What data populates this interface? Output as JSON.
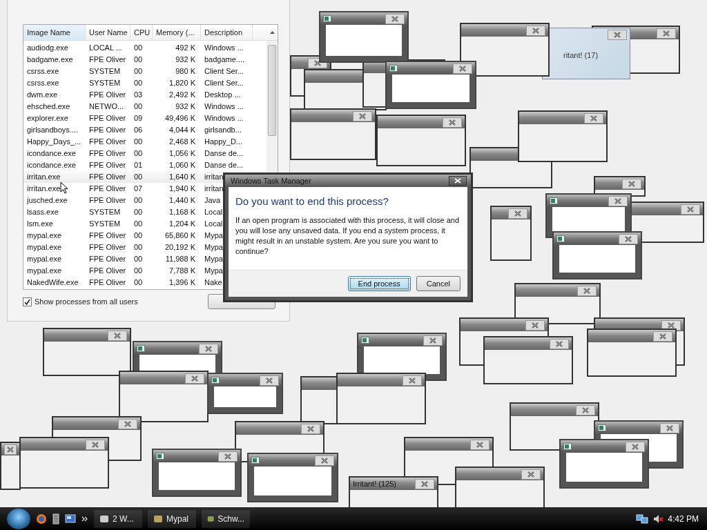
{
  "task_manager": {
    "columns": [
      {
        "label": "Image Name",
        "sorted": true
      },
      {
        "label": "User Name",
        "sorted": false
      },
      {
        "label": "CPU",
        "sorted": false
      },
      {
        "label": "Memory (...",
        "sorted": false
      },
      {
        "label": "Description",
        "sorted": false
      }
    ],
    "rows": [
      {
        "hovered": false,
        "cells": [
          "audiodg.exe",
          "LOCAL ...",
          "00",
          "492 K",
          "Windows ..."
        ]
      },
      {
        "hovered": false,
        "cells": [
          "badgame.exe",
          "FPE Oliver",
          "00",
          "932 K",
          "badgame...."
        ]
      },
      {
        "hovered": false,
        "cells": [
          "csrss.exe",
          "SYSTEM",
          "00",
          "980 K",
          "Client Ser..."
        ]
      },
      {
        "hovered": false,
        "cells": [
          "csrss.exe",
          "SYSTEM",
          "00",
          "1,820 K",
          "Client Ser..."
        ]
      },
      {
        "hovered": false,
        "cells": [
          "dwm.exe",
          "FPE Oliver",
          "03",
          "2,492 K",
          "Desktop ..."
        ]
      },
      {
        "hovered": false,
        "cells": [
          "ehsched.exe",
          "NETWO...",
          "00",
          "932 K",
          "Windows ..."
        ]
      },
      {
        "hovered": false,
        "cells": [
          "explorer.exe",
          "FPE Oliver",
          "09",
          "49,496 K",
          "Windows ..."
        ]
      },
      {
        "hovered": false,
        "cells": [
          "girlsandboys....",
          "FPE Oliver",
          "06",
          "4,044 K",
          "girlsandb..."
        ]
      },
      {
        "hovered": false,
        "cells": [
          "Happy_Days_...",
          "FPE Oliver",
          "00",
          "2,468 K",
          "Happy_D..."
        ]
      },
      {
        "hovered": false,
        "cells": [
          "icondance.exe",
          "FPE Oliver",
          "00",
          "1,056 K",
          "Danse de..."
        ]
      },
      {
        "hovered": false,
        "cells": [
          "icondance.exe",
          "FPE Oliver",
          "01",
          "1,060 K",
          "Danse de..."
        ]
      },
      {
        "hovered": true,
        "cells": [
          "irritan.exe",
          "FPE Oliver",
          "00",
          "1,640 K",
          "irritan"
        ]
      },
      {
        "hovered": false,
        "cells": [
          "irritan.exe",
          "FPE Oliver",
          "07",
          "1,940 K",
          "irritan"
        ]
      },
      {
        "hovered": false,
        "cells": [
          "jusched.exe",
          "FPE Oliver",
          "00",
          "1,440 K",
          "Java"
        ]
      },
      {
        "hovered": false,
        "cells": [
          "lsass.exe",
          "SYSTEM",
          "00",
          "1,168 K",
          "Local"
        ]
      },
      {
        "hovered": false,
        "cells": [
          "lsm.exe",
          "SYSTEM",
          "00",
          "1,204 K",
          "Local"
        ]
      },
      {
        "hovered": false,
        "cells": [
          "mypal.exe",
          "FPE Oliver",
          "00",
          "65,860 K",
          "Mypa"
        ]
      },
      {
        "hovered": false,
        "cells": [
          "mypal.exe",
          "FPE Oliver",
          "00",
          "20,192 K",
          "Mypa"
        ]
      },
      {
        "hovered": false,
        "cells": [
          "mypal.exe",
          "FPE Oliver",
          "00",
          "11,988 K",
          "Mypa"
        ]
      },
      {
        "hovered": false,
        "cells": [
          "mypal.exe",
          "FPE Oliver",
          "00",
          "7,788 K",
          "Mypa"
        ]
      },
      {
        "hovered": false,
        "cells": [
          "NakedWife.exe",
          "FPE Oliver",
          "00",
          "1,396 K",
          "Nake"
        ]
      }
    ],
    "show_all_users": {
      "label": "Show processes from all users",
      "checked": true
    }
  },
  "popups": [
    {
      "kind": "plain"
    },
    {
      "kind": "plain"
    },
    {
      "kind": "plain"
    },
    {
      "kind": "plain"
    },
    {
      "kind": "plain"
    },
    {
      "kind": "framed"
    },
    {
      "kind": "glass",
      "title": "ritant! (17)"
    },
    {
      "kind": "plain"
    },
    {
      "kind": "framed"
    },
    {
      "kind": "plain"
    },
    {
      "kind": "plain"
    },
    {
      "kind": "plain"
    },
    {
      "kind": "plain"
    },
    {
      "kind": "plain"
    },
    {
      "kind": "framed"
    },
    {
      "kind": "framed"
    },
    {
      "kind": "plain"
    },
    {
      "kind": "plain"
    },
    {
      "kind": "plain"
    },
    {
      "kind": "framed"
    },
    {
      "kind": "plain"
    },
    {
      "kind": "framed"
    },
    {
      "kind": "plain"
    },
    {
      "kind": "plain"
    },
    {
      "kind": "plain"
    },
    {
      "kind": "plain"
    },
    {
      "kind": "plain"
    },
    {
      "kind": "plain"
    },
    {
      "kind": "framed"
    },
    {
      "kind": "plain"
    },
    {
      "kind": "plain"
    },
    {
      "kind": "plain"
    },
    {
      "kind": "plain"
    },
    {
      "kind": "plain"
    },
    {
      "kind": "framed"
    },
    {
      "kind": "framed"
    },
    {
      "kind": "plain"
    },
    {
      "kind": "plain"
    },
    {
      "kind": "framed"
    },
    {
      "kind": "framed"
    },
    {
      "kind": "plain",
      "title": "Irritant! (125)"
    }
  ],
  "dialog": {
    "title": "Windows Task Manager",
    "heading": "Do you want to end this process?",
    "message": "If an open program is associated with this process, it will close and you will lose any unsaved data. If you end a system process, it might result in an unstable system. Are you sure you want to continue?",
    "buttons": [
      {
        "label": "End process",
        "selected": true
      },
      {
        "label": "Cancel",
        "selected": false
      }
    ]
  },
  "taskbar": {
    "items": [
      {
        "label": "2 W..."
      },
      {
        "label": "Mypal"
      },
      {
        "label": "Schw..."
      }
    ],
    "clock": "4:42 PM"
  }
}
